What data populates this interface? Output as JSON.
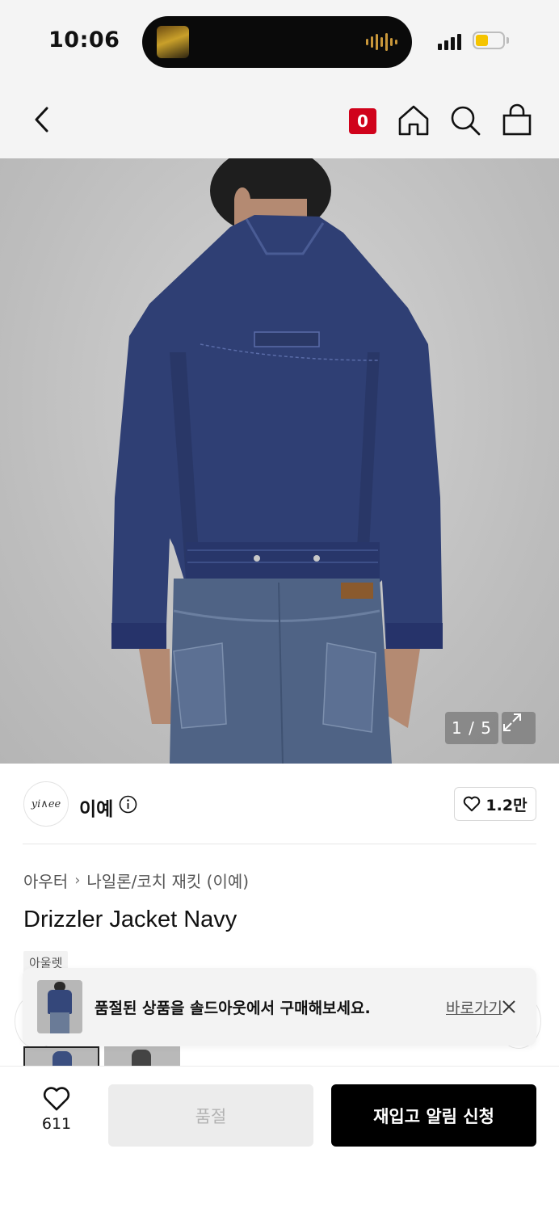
{
  "status_bar": {
    "time": "10:06",
    "battery_color": "#f5c400"
  },
  "nav": {
    "badge_count": "0",
    "badge_color": "#d0021b",
    "icons": [
      "back-icon",
      "home-icon",
      "search-icon",
      "bag-icon"
    ]
  },
  "gallery": {
    "counter": "1 / 5",
    "expand_icon": "expand-icon"
  },
  "brand": {
    "logo_text": "yi∧ee",
    "name": "이예",
    "like_count": "1.2만"
  },
  "product": {
    "breadcrumb": [
      "아우터",
      "나일론/코치 재킷 (이예)"
    ],
    "title": "Drizzler Jacket Navy",
    "tag": "아울렛"
  },
  "toast": {
    "message": "품절된 상품을 솔드아웃에서 구매해보세요.",
    "link": "바로가기"
  },
  "bottom_bar": {
    "wish_count": "611",
    "soldout_label": "품절",
    "restock_label": "재입고 알림 신청"
  }
}
